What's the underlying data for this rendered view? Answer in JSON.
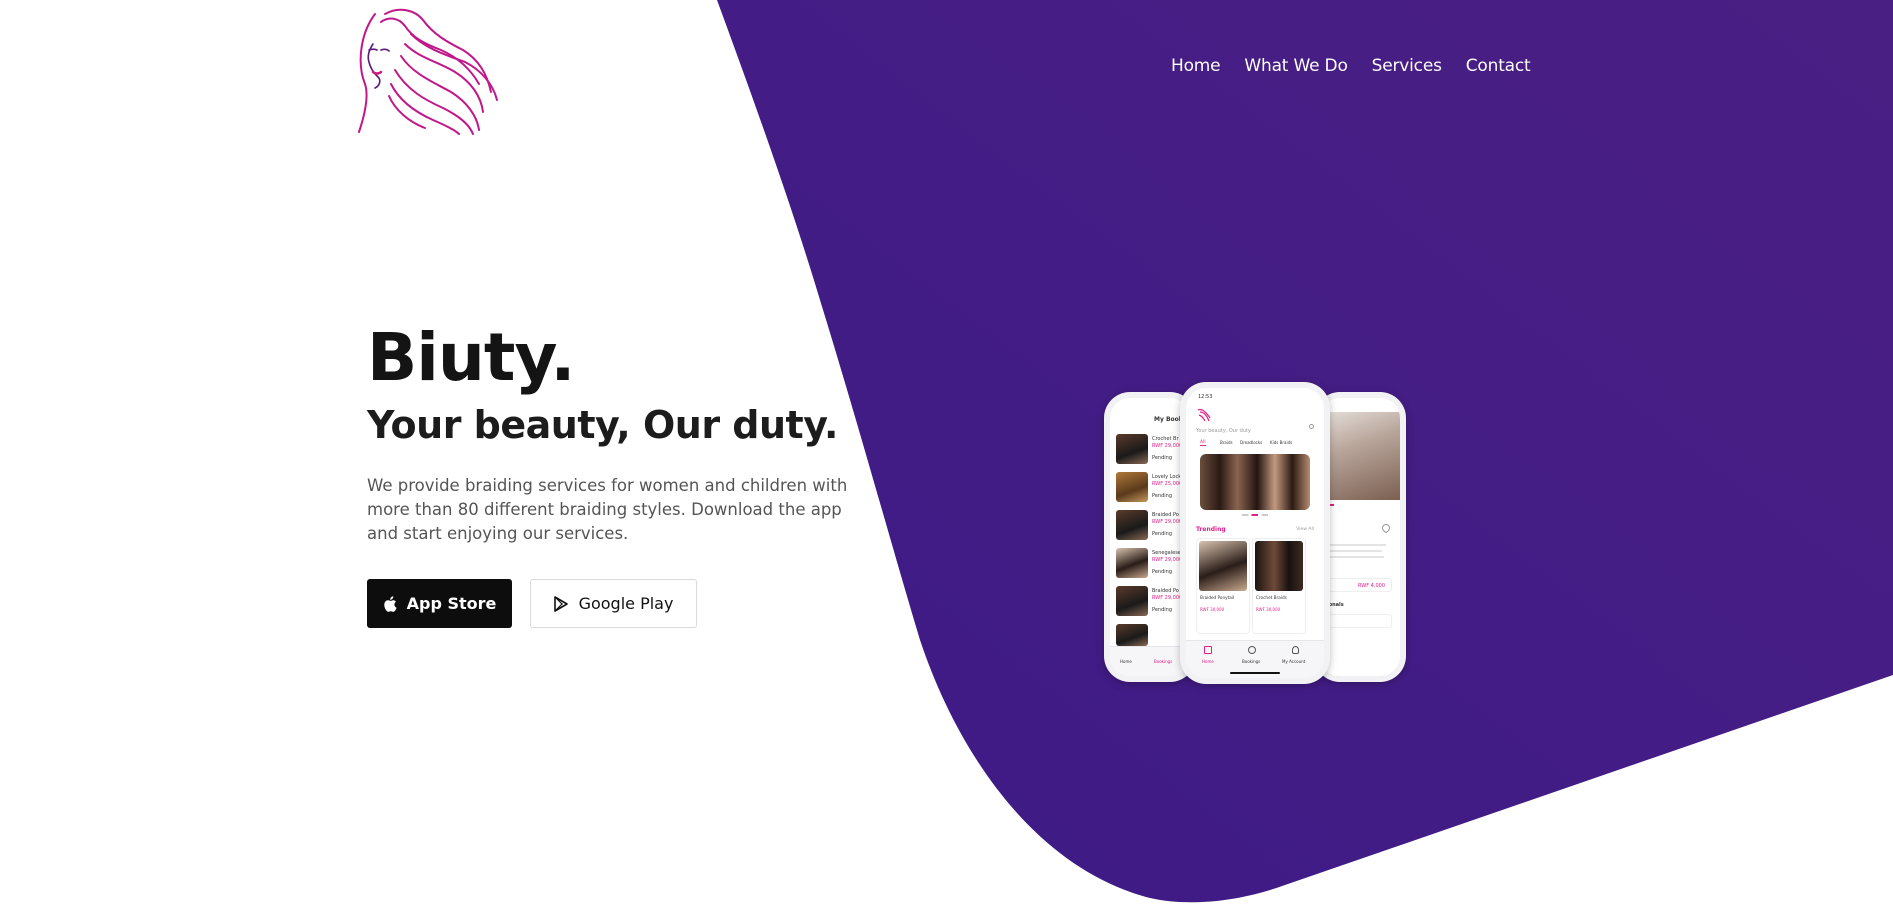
{
  "colors": {
    "primary_purple": "#421c85",
    "brand_pink": "#e0218a",
    "dark_button": "#0d0d0d"
  },
  "nav": {
    "items": [
      {
        "label": "Home"
      },
      {
        "label": "What We Do"
      },
      {
        "label": "Services"
      },
      {
        "label": "Contact"
      }
    ]
  },
  "hero": {
    "brand": "Biuty.",
    "tagline": "Your beauty, Our duty.",
    "description": "We provide braiding services for women and children with more than 80 different braiding styles. Download the app and start enjoying our services."
  },
  "buttons": {
    "app_store": {
      "label": "App Store",
      "icon": "apple-icon"
    },
    "google_play": {
      "label": "Google Play",
      "icon": "play-store-icon"
    }
  },
  "mockup": {
    "left_title": "My Book",
    "left_items": [
      {
        "name": "Crochet Br",
        "price": "RWF 29,000",
        "status": "Pending"
      },
      {
        "name": "Lovely Lock",
        "price": "RWF 25,000",
        "status": "Pending"
      },
      {
        "name": "Braided Po",
        "price": "RWF 29,000",
        "status": "Pending"
      },
      {
        "name": "Senegalese",
        "price": "RWF 29,000",
        "status": "Pending"
      },
      {
        "name": "Braided Po",
        "price": "RWF 29,000",
        "status": "Pending"
      }
    ],
    "center_time": "12:53",
    "center_subtitle": "Your beauty, Our duty",
    "center_tabs": [
      "All",
      "Braids",
      "Dreadlocks",
      "Kids Braids"
    ],
    "trending_label": "Trending",
    "view_all_label": "View All",
    "cards": [
      {
        "name": "Braided Ponytail",
        "price": "RWF 30,000"
      },
      {
        "name": "Crochet Braids",
        "price": "RWF 30,000"
      }
    ],
    "bottom_nav": [
      "Home",
      "Bookings",
      "My Account"
    ],
    "right_price": "RWF 4,000",
    "right_label": "sionals"
  }
}
